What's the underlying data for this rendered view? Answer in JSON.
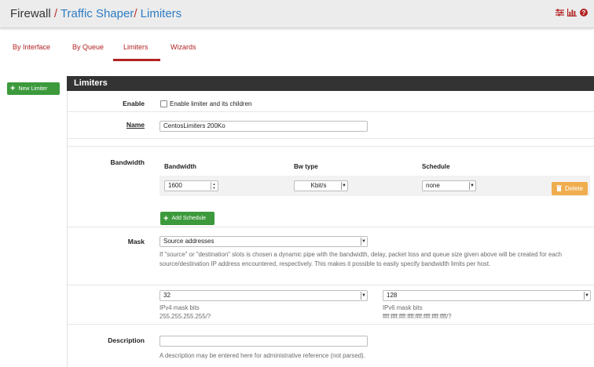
{
  "breadcrumb": {
    "part1": "Firewall",
    "sep1": "/",
    "part2": "Traffic Shaper",
    "sep2": "/",
    "part3": "Limiters"
  },
  "header_icons": [
    "sliders-icon",
    "bar-chart-icon",
    "help-icon"
  ],
  "colors": {
    "accent_red": "#b22222",
    "link_blue": "#2d7cc4",
    "success_green": "#3c9a3c",
    "warning_orange": "#f0ad4e",
    "panel_dark": "#333333"
  },
  "tabs": [
    {
      "label": "By Interface"
    },
    {
      "label": "By Queue"
    },
    {
      "label": "Limiters",
      "active": true
    },
    {
      "label": "Wizards"
    }
  ],
  "new_limiter_button": "New Limiter",
  "panel": {
    "title": "Limiters"
  },
  "form": {
    "enable": {
      "label": "Enable",
      "checkbox_label": "Enable limiter and its children",
      "checked": false
    },
    "name": {
      "label": "Name",
      "value": "CentosLimiters 200Ko"
    },
    "bandwidth": {
      "label": "Bandwidth",
      "columns": [
        "Bandwidth",
        "Bw type",
        "Schedule"
      ],
      "rows": [
        {
          "bandwidth": "1600",
          "bw_type": "Kbit/s",
          "schedule": "none"
        }
      ],
      "delete_label": "Delete",
      "add_schedule_label": "Add Schedule"
    },
    "mask": {
      "label": "Mask",
      "selected": "Source addresses",
      "help": "If \"source\" or \"destination\" slots is chosen a dynamic pipe with the bandwidth, delay, packet loss and queue size given above will be created for each source/destination IP address encountered, respectively. This makes it possible to easily specify bandwidth limits per host.",
      "ipv4_value": "32",
      "ipv4_label": "IPv4 mask bits",
      "ipv4_example": "255.255.255.255/?",
      "ipv6_value": "128",
      "ipv6_label": "IPv6 mask bits",
      "ipv6_example": "ffff:ffff:ffff:ffff:ffff:ffff:ffff:ffff/?"
    },
    "description": {
      "label": "Description",
      "value": "",
      "help": "A description may be entered here for administrative reference (not parsed)."
    }
  }
}
